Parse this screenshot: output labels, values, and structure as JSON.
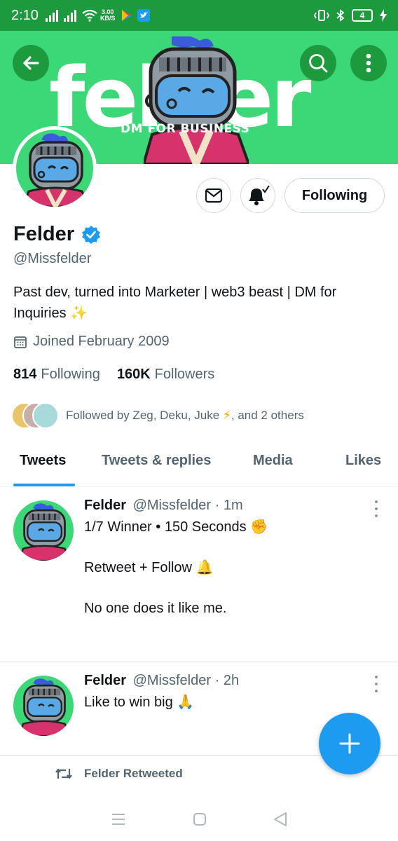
{
  "status_bar": {
    "time": "2:10",
    "net_speed_value": "3.00",
    "net_speed_unit": "KB/S",
    "battery": "4",
    "bg_color": "#1e9a3e"
  },
  "banner": {
    "big_word": "felder",
    "subtitle": "DM FOR BUSINESS",
    "bg_color": "#3cd877"
  },
  "profile": {
    "display_name": "Felder",
    "verified": true,
    "handle": "@Missfelder",
    "bio_line1": "Past dev, turned into Marketer | web3 beast | DM for",
    "bio_line2": "Inquiries",
    "bio_emoji": "✨",
    "joined": "Joined February 2009",
    "following_count": "814",
    "following_label": "Following",
    "followers_count": "160K",
    "followers_label": "Followers",
    "followed_by_prefix": "Followed by Zeg, Deku, Juke",
    "followed_by_emoji": "⚡",
    "followed_by_suffix": ", and 2 others",
    "follow_button": "Following"
  },
  "tabs": [
    {
      "label": "Tweets",
      "active": true
    },
    {
      "label": "Tweets & replies",
      "active": false
    },
    {
      "label": "Media",
      "active": false
    },
    {
      "label": "Likes",
      "active": false
    }
  ],
  "tweets": [
    {
      "name": "Felder",
      "handle": "@Missfelder",
      "sep": "·",
      "time": "1m",
      "line1": "1/7 Winner • 150 Seconds",
      "line1_emoji": "✊",
      "line2": "Retweet + Follow",
      "line2_emoji": "🔔",
      "line3": "No one does it like me."
    },
    {
      "name": "Felder",
      "handle": "@Missfelder",
      "sep": "·",
      "time": "2h",
      "line1": "Like to win big",
      "line1_emoji": "🙏"
    }
  ],
  "retweet_label": "Felder Retweeted",
  "accent_color": "#1d9bf0",
  "icons": [
    "back-arrow-icon",
    "search-icon",
    "more-vertical-icon",
    "mail-icon",
    "bell-icon",
    "verified-icon",
    "calendar-icon",
    "retweet-icon",
    "compose-plus-icon"
  ]
}
